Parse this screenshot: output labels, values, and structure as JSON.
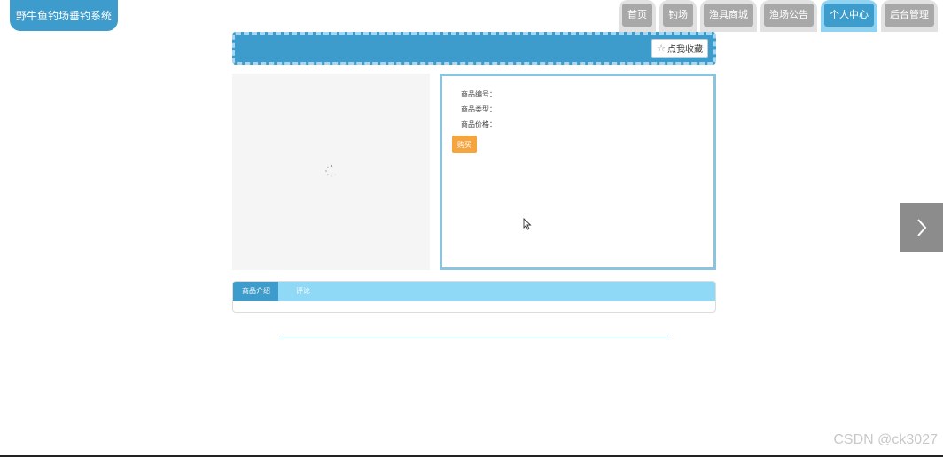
{
  "app": {
    "title": "野牛鱼钓场垂钓系统"
  },
  "nav": {
    "items": [
      {
        "label": "首页",
        "active": false
      },
      {
        "label": "钓场",
        "active": false
      },
      {
        "label": "渔具商城",
        "active": false
      },
      {
        "label": "渔场公告",
        "active": false
      },
      {
        "label": "个人中心",
        "active": true
      },
      {
        "label": "后台管理",
        "active": false
      }
    ]
  },
  "header": {
    "favorite_label": "点我收藏",
    "favorite_icon": "star-outline-icon"
  },
  "product": {
    "number_label": "商品编号：",
    "type_label": "商品类型：",
    "price_label": "商品价格：",
    "buy_label": "购买"
  },
  "tabs": [
    {
      "label": "商品介绍",
      "active": true
    },
    {
      "label": "评论",
      "active": false
    }
  ],
  "carousel": {
    "next_icon": "chevron-right-icon"
  },
  "watermark": "CSDN @ck3027",
  "colors": {
    "primary": "#3d9ccb",
    "light_blue": "#8fd9f7",
    "nav_inactive": "#a8a8a8",
    "buy_orange": "#f4a540"
  }
}
